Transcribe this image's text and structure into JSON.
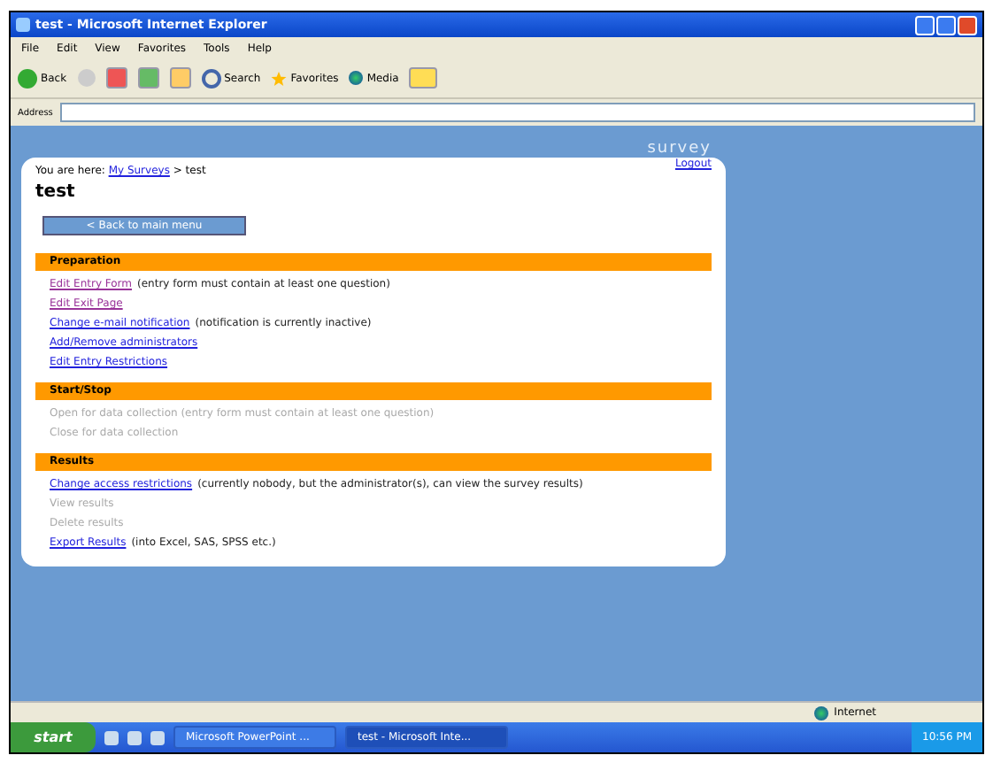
{
  "window": {
    "title": "test - Microsoft Internet Explorer"
  },
  "menu": [
    "File",
    "Edit",
    "View",
    "Favorites",
    "Tools",
    "Help"
  ],
  "toolbar": {
    "back": "Back",
    "search": "Search",
    "favorites": "Favorites",
    "media": "Media"
  },
  "address": {
    "label": "Address"
  },
  "page": {
    "logo": "survey",
    "breadcrumb": {
      "label": "You are here:",
      "link": "My Surveys",
      "current": "> test"
    },
    "logout": "Logout",
    "heading": "test",
    "back_button": "< Back to main menu",
    "sections": [
      {
        "title": "Preparation",
        "items": [
          {
            "link": "Edit Entry Form",
            "note": "(entry form must contain at least one question)",
            "visited": true,
            "disabled": false
          },
          {
            "link": "Edit Exit Page",
            "visited": true,
            "disabled": false
          },
          {
            "link": "Change e-mail notification",
            "note": "(notification is currently inactive)",
            "visited": false,
            "disabled": false
          },
          {
            "link": "Add/Remove administrators",
            "visited": false,
            "disabled": false
          },
          {
            "link": "Edit Entry Restrictions",
            "visited": false,
            "disabled": false
          }
        ]
      },
      {
        "title": "Start/Stop",
        "items": [
          {
            "link": "Open for data collection (entry form must contain at least one question)",
            "disabled": true
          },
          {
            "link": "Close for data collection",
            "disabled": true
          }
        ]
      },
      {
        "title": "Results",
        "items": [
          {
            "link": "Change access restrictions",
            "note": "(currently nobody, but the administrator(s), can view the survey results)",
            "visited": false,
            "disabled": false
          },
          {
            "link": "View results",
            "disabled": true
          },
          {
            "link": "Delete results",
            "disabled": true
          },
          {
            "link": "Export Results",
            "note": "(into Excel, SAS, SPSS etc.)",
            "visited": false,
            "disabled": false
          }
        ]
      }
    ]
  },
  "status_bar": {
    "zone": "Internet"
  },
  "taskbar": {
    "start": "start",
    "tasks": [
      {
        "label": "Microsoft PowerPoint ...",
        "selected": false
      },
      {
        "label": "test - Microsoft Inte...",
        "selected": true
      }
    ],
    "clock": "10:56 PM"
  }
}
